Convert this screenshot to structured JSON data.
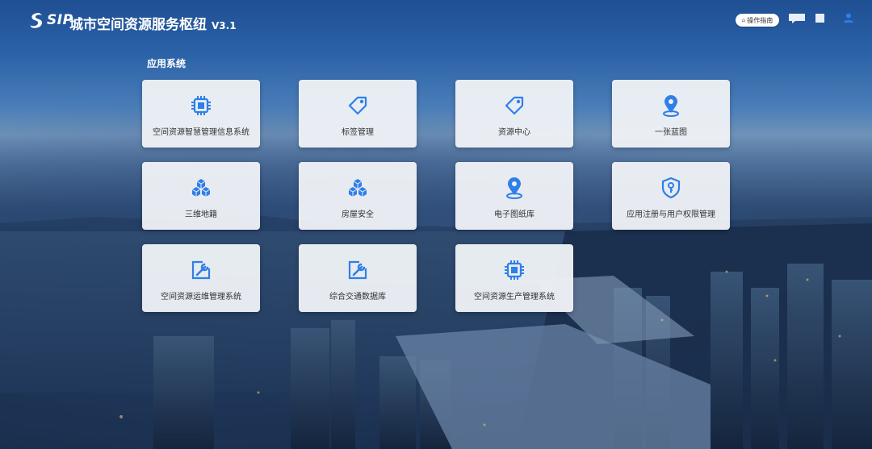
{
  "header": {
    "brand": "SIP",
    "title": "城市空间资源服务枢纽",
    "version": "V3.1",
    "guide_label": "操作指南"
  },
  "section": {
    "label": "应用系统"
  },
  "apps": [
    {
      "label": "空间资源智慧管理信息系统",
      "icon": "chip-icon"
    },
    {
      "label": "标签管理",
      "icon": "tag-icon"
    },
    {
      "label": "资源中心",
      "icon": "tag-icon"
    },
    {
      "label": "一张蓝图",
      "icon": "map-pin-icon"
    },
    {
      "label": "三维地籍",
      "icon": "cubes-icon"
    },
    {
      "label": "房屋安全",
      "icon": "cubes-icon"
    },
    {
      "label": "电子图纸库",
      "icon": "map-pin-icon"
    },
    {
      "label": "应用注册与用户权限管理",
      "icon": "shield-key-icon"
    },
    {
      "label": "空间资源运维管理系统",
      "icon": "edit-wrench-icon"
    },
    {
      "label": "综合交通数据库",
      "icon": "edit-wrench-icon"
    },
    {
      "label": "空间资源生产管理系统",
      "icon": "chip-icon"
    }
  ],
  "colors": {
    "accent": "#2f7fe8",
    "tile_bg": "#eef1f6"
  }
}
